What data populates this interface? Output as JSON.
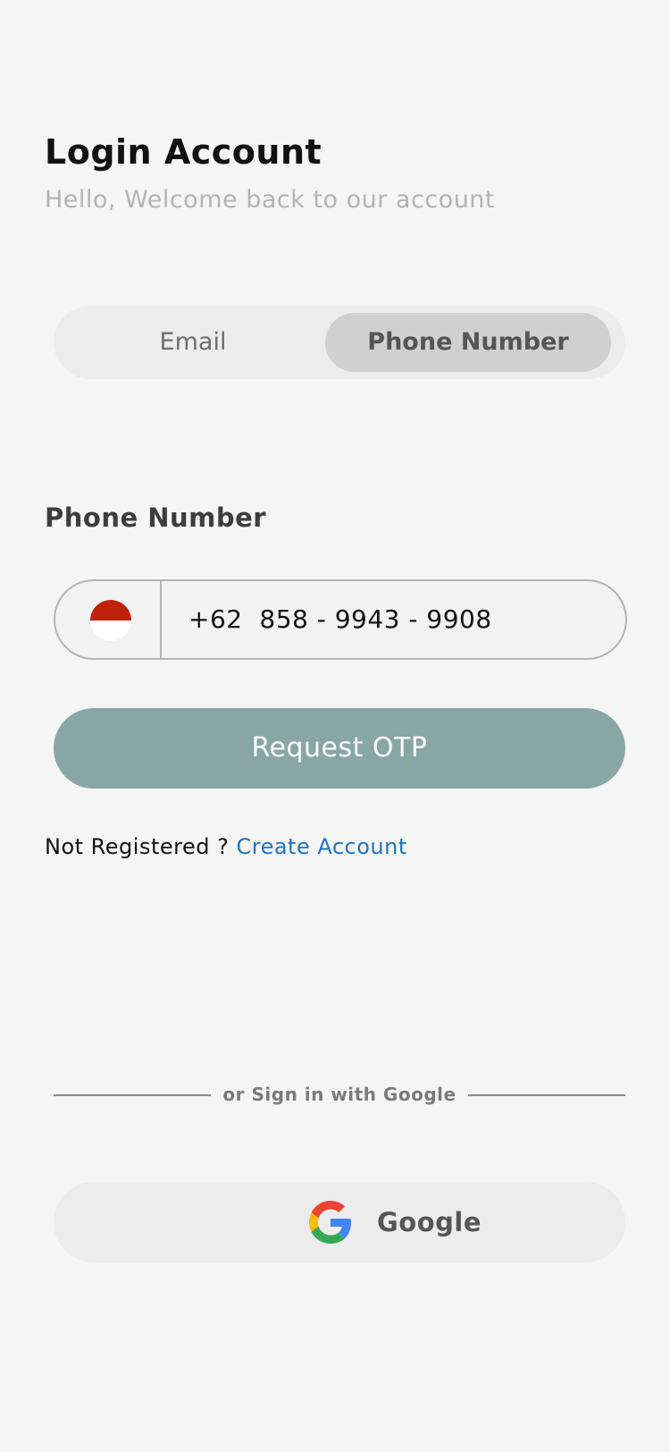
{
  "header": {
    "title": "Login Account",
    "subtitle": "Hello, Welcome back to our account"
  },
  "login_method_toggle": {
    "options": [
      "Email",
      "Phone Number"
    ],
    "selected": "Phone Number"
  },
  "phone_field": {
    "label": "Phone Number",
    "country_flag": "indonesia-flag-icon",
    "value": "+62  858 - 9943 - 9908"
  },
  "actions": {
    "request_otp_label": "Request OTP"
  },
  "register": {
    "prompt": "Not Registered ? ",
    "link_label": "Create Account"
  },
  "social": {
    "divider_text": "or Sign in with Google",
    "google_label": "Google",
    "google_icon": "google-icon"
  },
  "colors": {
    "background": "#f5f5f5",
    "primary_button": "#88a6a6",
    "link": "#1e73c8",
    "toggle_selected": "#d0d0d0"
  }
}
